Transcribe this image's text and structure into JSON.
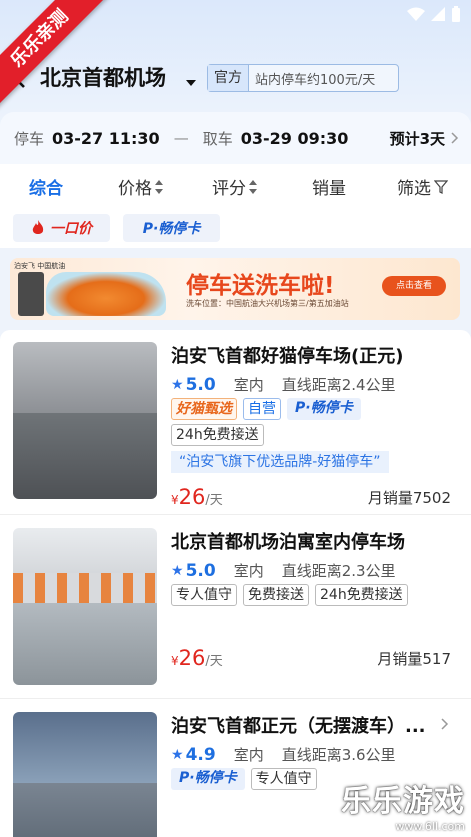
{
  "ribbon": "乐乐亲测",
  "header": {
    "city": "北京首都机场",
    "notice_tag": "官方",
    "notice_text": "站内停车约100元/天"
  },
  "time_card": {
    "park_label": "停车",
    "park_time": "03-27 11:30",
    "dash": "—",
    "pick_label": "取车",
    "pick_time": "03-29 09:30",
    "estimate": "预计3天"
  },
  "tabs": [
    {
      "label": "综合",
      "active": true
    },
    {
      "label": "价格"
    },
    {
      "label": "评分"
    },
    {
      "label": "销量"
    },
    {
      "label": "筛选"
    }
  ],
  "chips": {
    "fixed_price": "一口价",
    "easy_card": "P·畅停卡"
  },
  "banner": {
    "logos": "泊安飞  中国航油",
    "headline": "停车送洗车啦!",
    "location": "洗车位置：中国航油大兴机场第三/第五加油站",
    "button": "点击查看"
  },
  "listings": [
    {
      "name": "泊安飞首都好猫停车场(正元)",
      "score": "5.0",
      "type": "室内",
      "distance": "直线距离2.4公里",
      "tags": [
        "好猫甄选",
        "自营",
        "P·畅停卡",
        "24h免费接送"
      ],
      "slogan": "“泊安飞旗下优选品牌-好猫停车”",
      "price_symbol": "¥",
      "price": "26",
      "price_unit": "/天",
      "sales": "月销量7502"
    },
    {
      "name": "北京首都机场泊寓室内停车场",
      "score": "5.0",
      "type": "室内",
      "distance": "直线距离2.3公里",
      "tags": [
        "专人值守",
        "免费接送",
        "24h免费接送"
      ],
      "price_symbol": "¥",
      "price": "26",
      "price_unit": "/天",
      "sales": "月销量517"
    },
    {
      "name": "泊安飞首都正元（无摆渡车）...",
      "score": "4.9",
      "type": "室内",
      "distance": "直线距离3.6公里",
      "tags": [
        "P·畅停卡",
        "专人值守"
      ]
    }
  ],
  "watermark": {
    "title": "乐乐游戏",
    "url": "www.6ll.com"
  }
}
